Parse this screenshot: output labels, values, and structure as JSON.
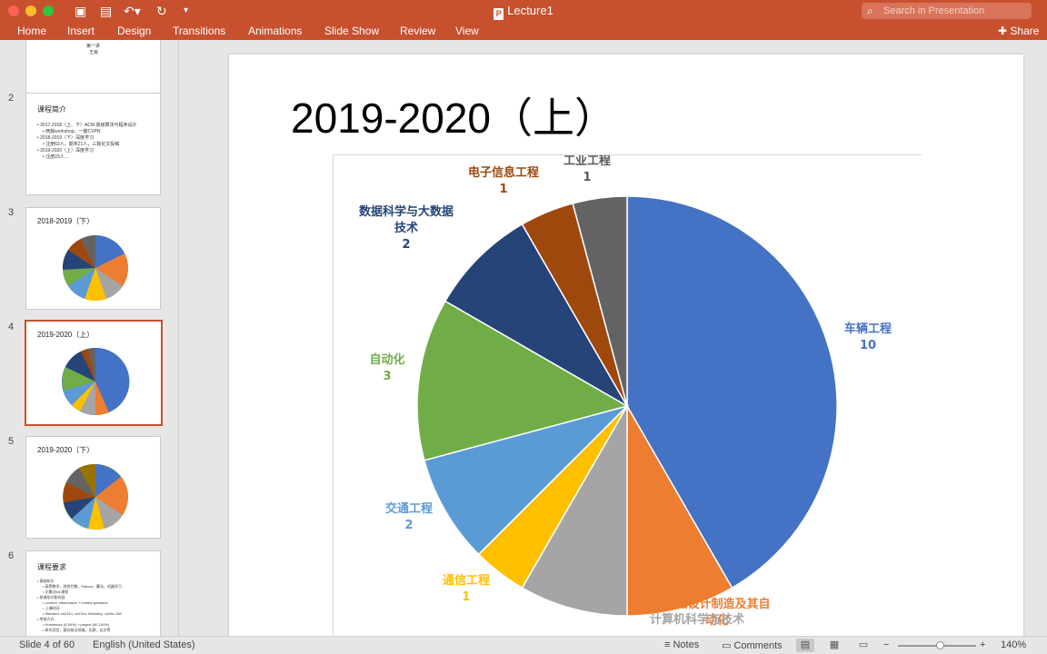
{
  "window": {
    "title": "Lecture1",
    "search_placeholder": "Search in Presentation"
  },
  "ribbon": {
    "tabs": [
      "Home",
      "Insert",
      "Design",
      "Transitions",
      "Animations",
      "Slide Show",
      "Review",
      "View"
    ],
    "share_label": "Share"
  },
  "thumbnails": [
    {
      "number": "",
      "title": "",
      "lines": [
        "第一讲",
        "王嵩"
      ]
    },
    {
      "number": "2",
      "title": "课程简介",
      "lines": [
        "• 2017-2018（上、下）ACM 高级算法与程序设计",
        "• 两篇workshop，一篇CVPR",
        "• 2018-2019（下）深度学习",
        "• 注册63人，期末21人，三篇论文投稿",
        "• 2019-2020（上）深度学习",
        "• 注册23人…"
      ]
    },
    {
      "number": "3",
      "title": "2018-2019（下）"
    },
    {
      "number": "4",
      "title": "2019-2020（上）"
    },
    {
      "number": "5",
      "title": "2019-2020（下）"
    },
    {
      "number": "6",
      "title": "课程要求",
      "lines": [
        "• 基础知识",
        "• 高等数学、线性代数、Python、算法、机器学习",
        "• 无需过ML课程",
        "• 授课形式和内容",
        "• Lecture +discussion + invited speakers",
        "• 上课时间",
        "• Stanford: cs231n, cs224n; Berkeley: cs294-158",
        "• 考核方式",
        "• Homework (0-50%) + project (50-100%)",
        "• 研究项目，面向前沿领域，比赛，论文等"
      ]
    }
  ],
  "slide": {
    "title": "2019-2020（上）"
  },
  "chart_data": {
    "type": "pie",
    "title": "",
    "categories": [
      "车辆工程",
      "机械设计制造及其自动化",
      "计算机科学与技术",
      "通信工程",
      "交通工程",
      "自动化",
      "数据科学与大数据技术",
      "电子信息工程",
      "工业工程"
    ],
    "values": [
      10,
      2,
      2,
      1,
      2,
      3,
      2,
      1,
      1
    ],
    "value_labels": [
      "10",
      "",
      "",
      "1",
      "2",
      "3",
      "2",
      "1",
      "1"
    ],
    "colors": [
      "#4472c4",
      "#ed7d31",
      "#a5a5a5",
      "#ffc000",
      "#5b9bd5",
      "#70ad47",
      "#264478",
      "#9e480e",
      "#636363"
    ],
    "label_colors": [
      "#4472c4",
      "#ed7d31",
      "#a5a5a5",
      "#ffc000",
      "#5b9bd5",
      "#70ad47",
      "#264478",
      "#9e480e",
      "#595959"
    ],
    "legend": "none"
  },
  "status": {
    "slide_indicator": "Slide 4 of 60",
    "language": "English (United States)",
    "notes_label": "Notes",
    "comments_label": "Comments",
    "zoom": "140%"
  }
}
